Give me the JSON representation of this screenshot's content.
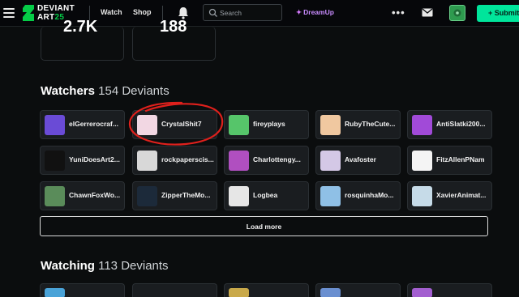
{
  "nav": {
    "logo_line1": "DEVIANT",
    "logo_line2": "ART",
    "logo_suffix": "25",
    "watch_label": "Watch",
    "shop_label": "Shop",
    "search_placeholder": "Search",
    "dreamup_label": "DreamUp",
    "more_label": "•••",
    "submit_label": "+ Submit"
  },
  "stats": {
    "left_value": "2.7K",
    "right_value": "188"
  },
  "watchers": {
    "title": "Watchers",
    "count": "154 Deviants",
    "users": [
      {
        "name": "elGerrerocraf...",
        "avatar_color": "#6a4bd6"
      },
      {
        "name": "CrystalShit7",
        "avatar_color": "#f2d7e3"
      },
      {
        "name": "fireyplays",
        "avatar_color": "#56c56a"
      },
      {
        "name": "RubyTheCute...",
        "avatar_color": "#f0c8a0"
      },
      {
        "name": "AntiSlatki200...",
        "avatar_color": "#a14ad8"
      },
      {
        "name": "YuniDoesArt2...",
        "avatar_color": "#111111"
      },
      {
        "name": "rockpaperscis...",
        "avatar_color": "#d8d8d8"
      },
      {
        "name": "Charlottengy...",
        "avatar_color": "#b04fc0"
      },
      {
        "name": "Avafoster",
        "avatar_color": "#d4c8e6"
      },
      {
        "name": "FitzAllenPNam",
        "avatar_color": "#f4f4f4"
      },
      {
        "name": "ChawnFoxWo...",
        "avatar_color": "#5a8c5a"
      },
      {
        "name": "ZipperTheMo...",
        "avatar_color": "#1c2a3a"
      },
      {
        "name": "Logbea",
        "avatar_color": "#e6e6e6"
      },
      {
        "name": "rosquinhaMo...",
        "avatar_color": "#8fc0e6"
      },
      {
        "name": "XavierAnimat...",
        "avatar_color": "#c6dbe8"
      }
    ],
    "load_more_label": "Load more"
  },
  "watching": {
    "title": "Watching",
    "count": "113 Deviants"
  },
  "colors": {
    "accent_green": "#05cc47",
    "submit_bg": "#00e59b",
    "dreamup": "#c98cff",
    "annotation_red": "#e0201c"
  }
}
